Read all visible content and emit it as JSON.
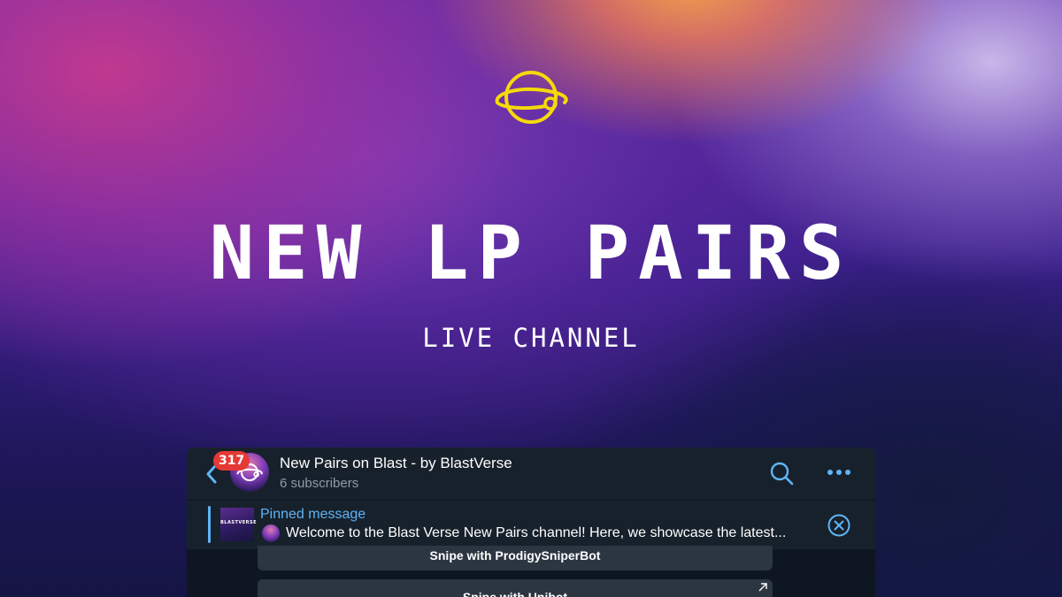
{
  "hero": {
    "logo_icon": "planet-ring-icon",
    "headline": "NEW LP PAIRS",
    "subheadline": "LIVE CHANNEL"
  },
  "telegram": {
    "header": {
      "back_icon": "chevron-left-icon",
      "unread_count": "317",
      "channel_title": "New Pairs on Blast - by BlastVerse",
      "subscribers": "6 subscribers",
      "search_icon": "search-icon",
      "more_icon": "more-dots-icon"
    },
    "pinned": {
      "label": "Pinned message",
      "thumbnail_text": "BLASTVERSE",
      "text": "Welcome to the Blast Verse New Pairs channel!  Here, we showcase the latest...",
      "close_icon": "close-circle-icon"
    },
    "buttons": [
      {
        "label": "Snipe with ProdigySniperBot"
      },
      {
        "label": "Snipe with Unibot",
        "icon": "external-arrow-icon"
      }
    ]
  },
  "colors": {
    "accent_yellow": "#f5d90a",
    "telegram_blue": "#5eb5f7",
    "badge_red": "#e53935",
    "panel_bg": "#17212b"
  }
}
